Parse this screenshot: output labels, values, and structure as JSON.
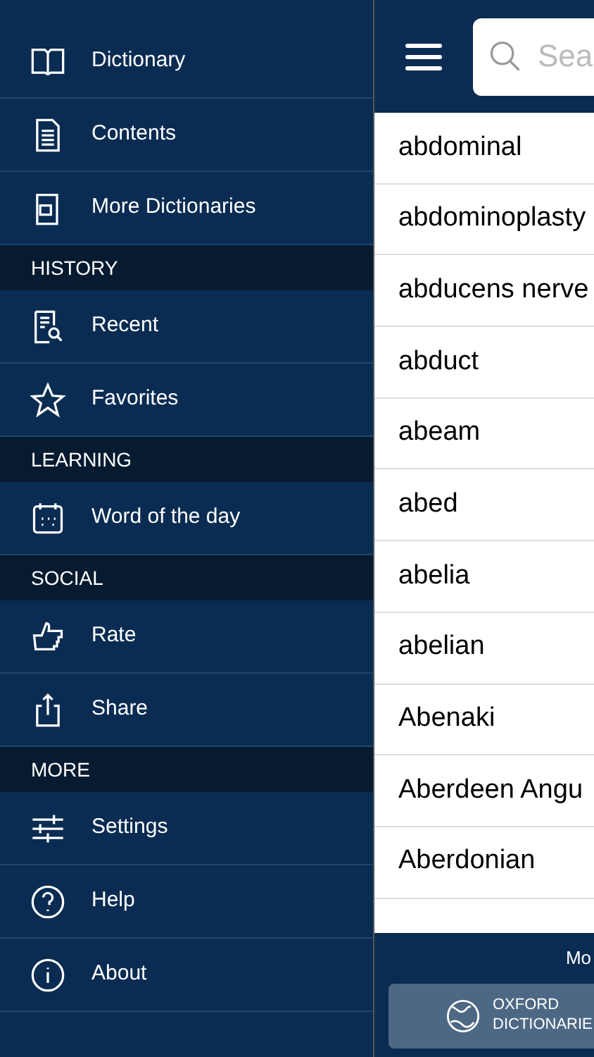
{
  "sidebar": {
    "sections": [
      {
        "items": [
          {
            "kind": "book",
            "label": "Dictionary"
          },
          {
            "kind": "document",
            "label": "Contents"
          },
          {
            "kind": "ab-book",
            "label": "More Dictionaries"
          }
        ]
      },
      {
        "header": "HISTORY",
        "items": [
          {
            "kind": "recent",
            "label": "Recent"
          },
          {
            "kind": "star",
            "label": "Favorites"
          }
        ]
      },
      {
        "header": "LEARNING",
        "items": [
          {
            "kind": "calendar",
            "label": "Word of the day"
          }
        ]
      },
      {
        "header": "SOCIAL",
        "items": [
          {
            "kind": "thumb",
            "label": "Rate"
          },
          {
            "kind": "share",
            "label": "Share"
          }
        ]
      },
      {
        "header": "MORE",
        "items": [
          {
            "kind": "sliders",
            "label": "Settings"
          },
          {
            "kind": "help",
            "label": "Help"
          },
          {
            "kind": "info",
            "label": "About"
          }
        ]
      }
    ]
  },
  "search": {
    "placeholder": "Sea"
  },
  "words": [
    "abdominal",
    "abdominoplasty",
    "abducens nerve",
    "abduct",
    "abeam",
    "abed",
    "abelia",
    "abelian",
    "Abenaki",
    "Aberdeen Angu",
    "Aberdonian"
  ],
  "footer": {
    "caption": "Mo",
    "brand_line_1": "OXFORD",
    "brand_line_2": "DICTIONARIE"
  }
}
